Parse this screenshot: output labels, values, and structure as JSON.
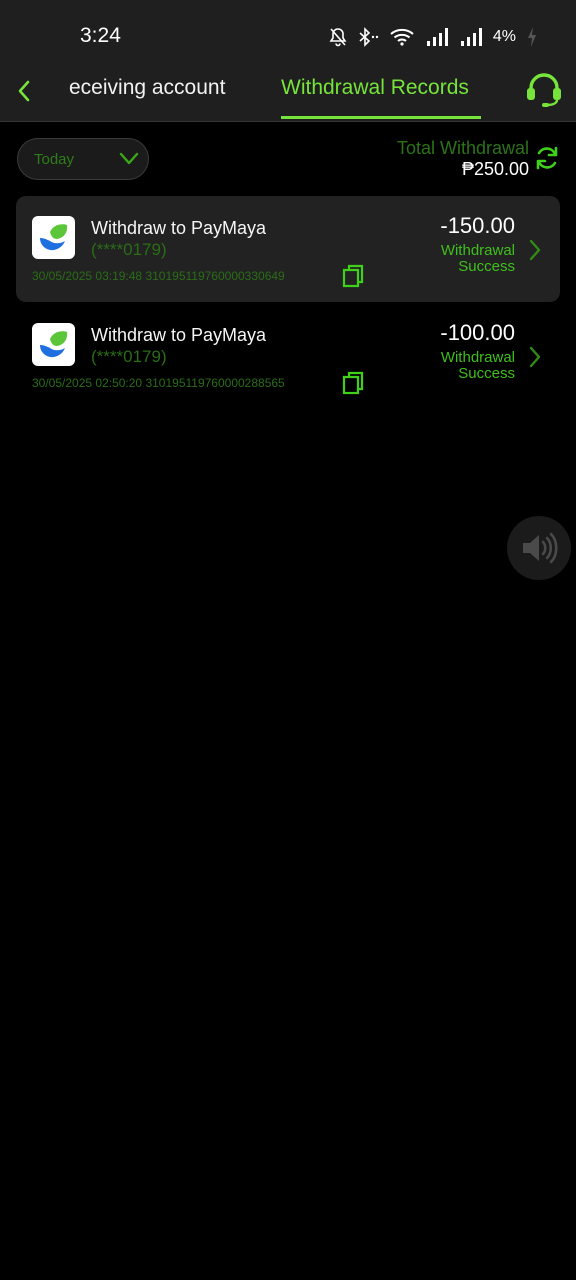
{
  "status_bar": {
    "time": "3:24",
    "battery": "4%",
    "icons": [
      "bell-muted-icon",
      "bluetooth-icon",
      "wifi-icon",
      "signal-icon",
      "signal-icon",
      "battery-icon"
    ]
  },
  "header": {
    "tabs": [
      {
        "label": "eceiving account",
        "active": false
      },
      {
        "label": "Withdrawal Records",
        "active": true
      }
    ],
    "back_icon": "chevron-left-icon",
    "support_icon": "headset-icon"
  },
  "filter": {
    "date_value": "Today",
    "total_label": "Total Withdrawal",
    "total_amount": "₱250.00",
    "refresh_icon": "refresh-icon"
  },
  "records": [
    {
      "title": "Withdraw to PayMaya",
      "account": "(****0179)",
      "datetime": "30/05/2025 03:19:48",
      "order_no": "3101951197600003306​49",
      "amount": "-150.00",
      "status_line1": "Withdrawal",
      "status_line2": "Success"
    },
    {
      "title": "Withdraw to PayMaya",
      "account": "(****0179)",
      "datetime": "30/05/2025 02:50:20",
      "order_no": "310195119760000288565",
      "amount": "-100.00",
      "status_line1": "Withdrawal",
      "status_line2": "Success"
    }
  ],
  "colors": {
    "accent": "#76e43a",
    "dim_green": "#2a6d17",
    "background": "#000000",
    "bar_bg": "#1f1f1f"
  }
}
